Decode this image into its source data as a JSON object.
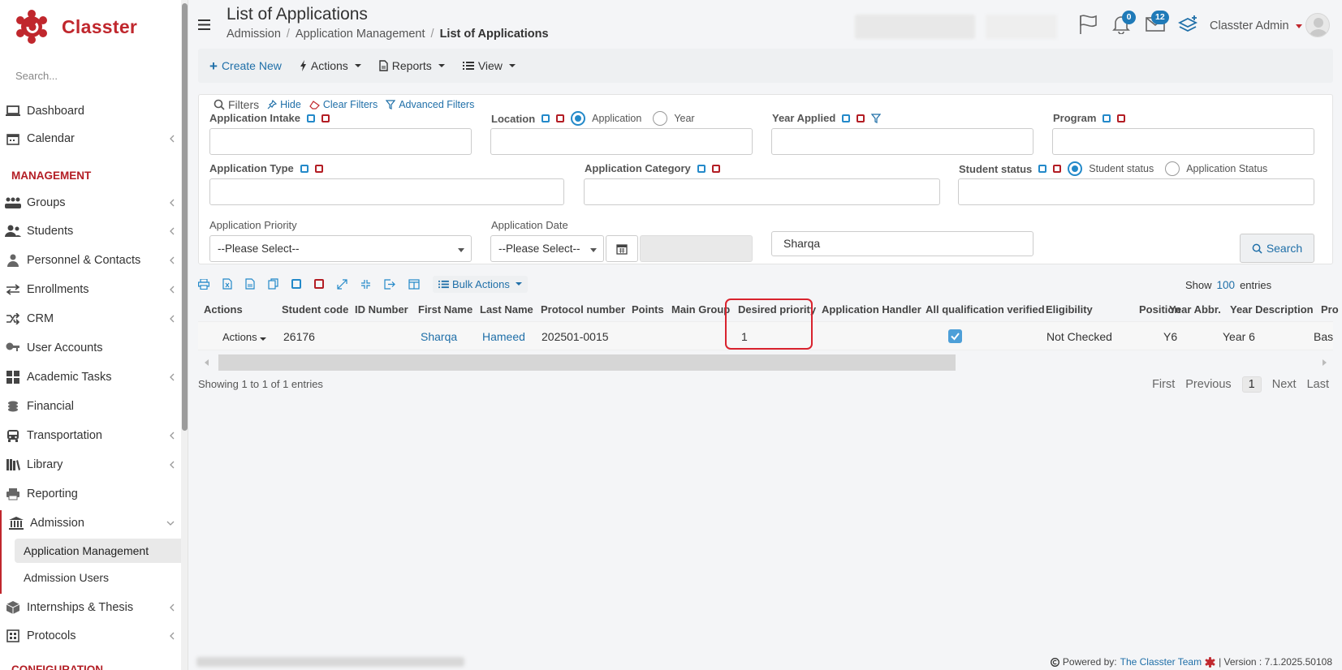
{
  "brand": {
    "name": "Classter"
  },
  "sidebar": {
    "search_placeholder": "Search...",
    "items": [
      {
        "label": "Dashboard"
      },
      {
        "label": "Calendar"
      },
      {
        "label": "Groups"
      },
      {
        "label": "Students"
      },
      {
        "label": "Personnel & Contacts"
      },
      {
        "label": "Enrollments"
      },
      {
        "label": "CRM"
      },
      {
        "label": "User Accounts"
      },
      {
        "label": "Academic Tasks"
      },
      {
        "label": "Financial"
      },
      {
        "label": "Transportation"
      },
      {
        "label": "Library"
      },
      {
        "label": "Reporting"
      },
      {
        "label": "Admission"
      },
      {
        "label": "Internships & Thesis"
      },
      {
        "label": "Protocols"
      }
    ],
    "section_management": "MANAGEMENT",
    "section_configuration": "CONFIGURATION",
    "admission_sub": [
      {
        "label": "Application Management"
      },
      {
        "label": "Admission Users"
      }
    ]
  },
  "header": {
    "title": "List of Applications",
    "breadcrumb": [
      "Admission",
      "Application Management",
      "List of Applications"
    ],
    "notifications_count": "0",
    "messages_count": "12",
    "user_name": "Classter Admin"
  },
  "toolbar": {
    "create_new": "Create New",
    "actions": "Actions",
    "reports": "Reports",
    "view": "View"
  },
  "filters": {
    "title": "Filters",
    "hide": "Hide",
    "clear": "Clear Filters",
    "advanced": "Advanced Filters",
    "application_intake": "Application Intake",
    "location": "Location",
    "location_radio_1": "Application",
    "location_radio_2": "Year",
    "year_applied": "Year Applied",
    "program": "Program",
    "application_type": "Application Type",
    "application_category": "Application Category",
    "student_status": "Student status",
    "status_radio_1": "Student status",
    "status_radio_2": "Application Status",
    "application_priority": "Application Priority",
    "priority_value": "--Please Select--",
    "application_date": "Application Date",
    "date_value": "--Please Select--",
    "search_value": "Sharqa",
    "search_button": "Search"
  },
  "table": {
    "bulk_actions": "Bulk Actions",
    "show_label": "Show",
    "show_count": "100",
    "entries_label": "entries",
    "columns": [
      "Actions",
      "Student code",
      "ID Number",
      "First Name",
      "Last Name",
      "Protocol number",
      "Points",
      "Main Group",
      "Desired priority",
      "Application Handler",
      "All qualification verified",
      "Eligibility",
      "Position",
      "Year Abbr.",
      "Year Description",
      "Pro"
    ],
    "row": {
      "actions": "Actions",
      "student_code": "26176",
      "first_name": "Sharqa",
      "last_name": "Hameed",
      "protocol_number": "202501-0015",
      "desired_priority": "1",
      "eligibility": "Not Checked",
      "year_abbr": "Y6",
      "year_description": "Year 6",
      "program_partial": "Bas"
    },
    "showing": "Showing 1 to 1 of 1 entries",
    "pager": {
      "first": "First",
      "previous": "Previous",
      "page": "1",
      "next": "Next",
      "last": "Last"
    }
  },
  "footer": {
    "powered_by": "Powered by:",
    "team": "The Classter Team",
    "version": "| Version : 7.1.2025.50108"
  },
  "colors": {
    "brand_red": "#c0272d",
    "link_blue": "#1f6fa8",
    "badge_blue": "#1f7ab8",
    "highlight_red": "#d9232e"
  }
}
